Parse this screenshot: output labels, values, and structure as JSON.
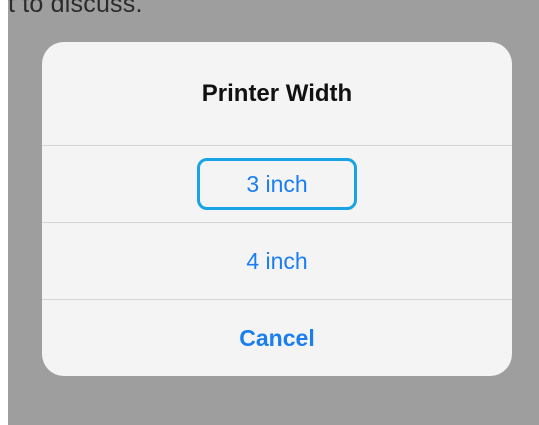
{
  "background": {
    "text": "t to discuss."
  },
  "alert": {
    "title": "Printer Width",
    "actions": [
      {
        "label": "3 inch",
        "focused": true
      },
      {
        "label": "4 inch",
        "focused": false
      },
      {
        "label": "Cancel",
        "style": "cancel"
      }
    ]
  },
  "colors": {
    "accent": "#1a7ef1",
    "focus_ring": "#18a4e4",
    "dim_overlay": "#9e9e9e",
    "alert_bg": "#f4f4f5",
    "separator": "#d6d6d8"
  }
}
